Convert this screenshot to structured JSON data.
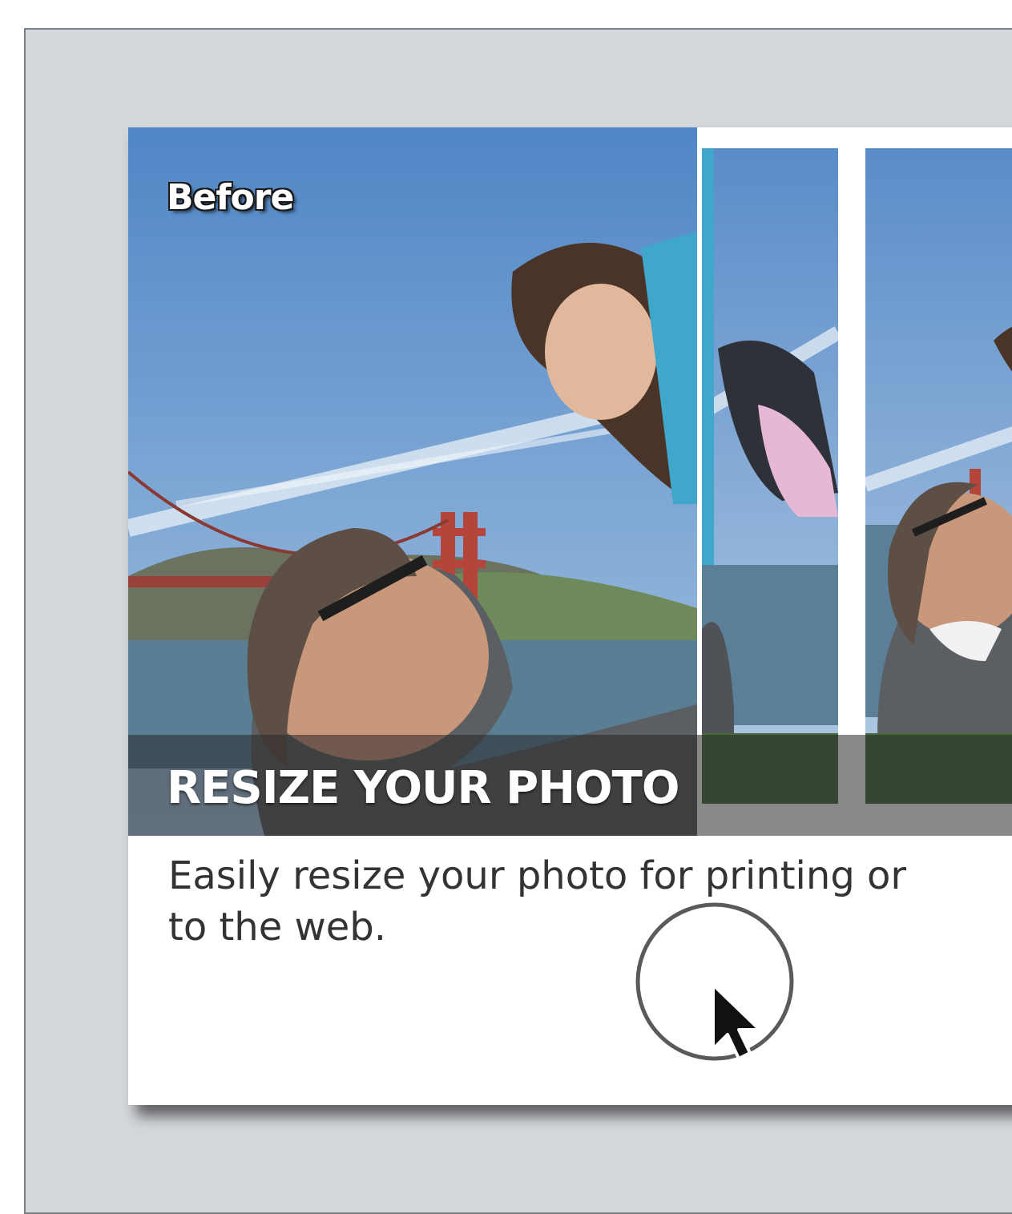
{
  "card": {
    "before_label": "Before",
    "title": "RESIZE YOUR PHOTO",
    "description": "Easily resize your photo for printing or\nto the web."
  },
  "colors": {
    "panel_background": "#d4d7dc",
    "card_background": "#ffffff",
    "sky": "#7aa3cf",
    "bay": "#5a7f95",
    "bridge": "#b5443a",
    "caption_band": "#282828"
  },
  "icons": {
    "cursor": "mouse-pointer-icon",
    "click_indicator": "click-ring-icon"
  }
}
